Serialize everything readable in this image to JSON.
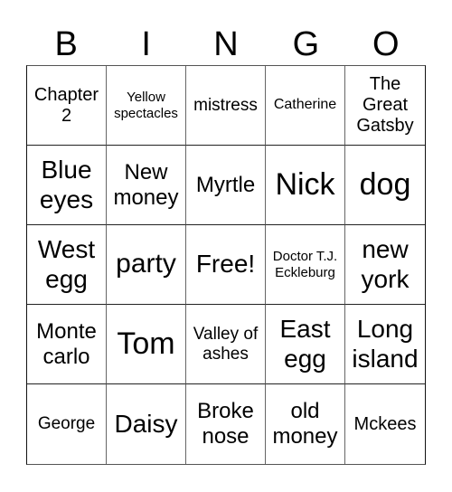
{
  "header": {
    "letters": [
      "B",
      "I",
      "N",
      "G",
      "O"
    ]
  },
  "board": {
    "cells": [
      [
        "Chapter 2",
        "Yellow spectacles",
        "mistress",
        "Catherine",
        "The Great Gatsby"
      ],
      [
        "Blue eyes",
        "New money",
        "Myrtle",
        "Nick",
        "dog"
      ],
      [
        "West egg",
        "party",
        "Free!",
        "Doctor T.J. Eckleburg",
        "new york"
      ],
      [
        "Monte carlo",
        "Tom",
        "Valley of ashes",
        "East egg",
        "Long island"
      ],
      [
        "George",
        "Daisy",
        "Broke nose",
        "old money",
        "Mckees"
      ]
    ],
    "free_space": "Free!"
  }
}
